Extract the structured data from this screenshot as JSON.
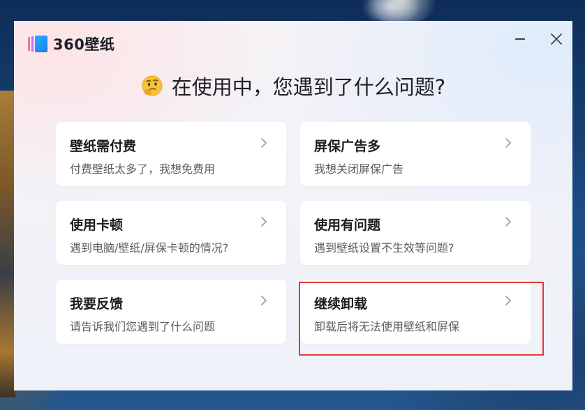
{
  "app": {
    "name": "360壁纸"
  },
  "window": {
    "minimize_icon": "minimize-icon",
    "close_icon": "close-icon"
  },
  "heading": {
    "emoji": "thinking-face-emoji",
    "text": "在使用中，您遇到了什么问题?"
  },
  "options": [
    {
      "title": "壁纸需付费",
      "subtitle": "付费壁纸太多了，我想免费用"
    },
    {
      "title": "屏保广告多",
      "subtitle": "我想关闭屏保广告"
    },
    {
      "title": "使用卡顿",
      "subtitle": "遇到电脑/壁纸/屏保卡顿的情况?"
    },
    {
      "title": "使用有问题",
      "subtitle": "遇到壁纸设置不生效等问题?"
    },
    {
      "title": "我要反馈",
      "subtitle": "请告诉我们您遇到了什么问题"
    },
    {
      "title": "继续卸载",
      "subtitle": "卸载后将无法使用壁纸和屏保"
    }
  ],
  "colors": {
    "highlight_border": "#e03a3a",
    "card_background": "#ffffff",
    "title_text": "#1e1f24",
    "subtitle_text": "#5a5c63"
  }
}
